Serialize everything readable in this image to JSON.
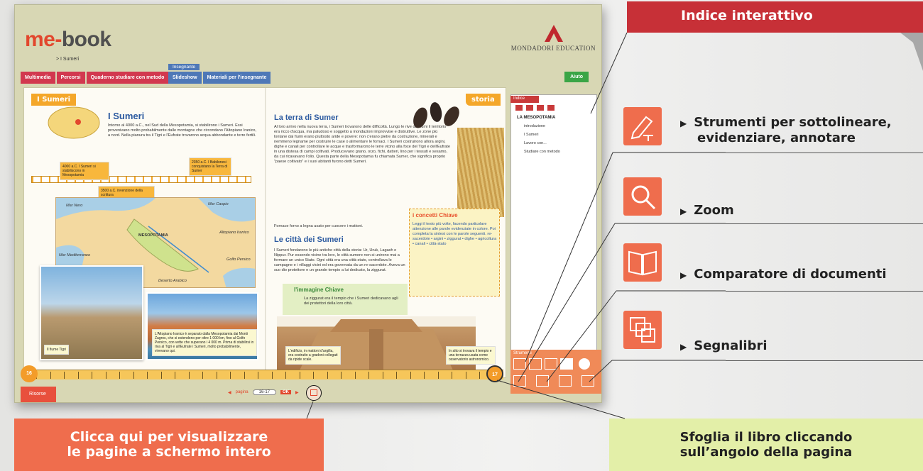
{
  "app": {
    "logo_me": "me-",
    "logo_book": "book",
    "breadcrumb": "> I Sumeri",
    "publisher": "MONDADORI EDUCATION",
    "tabs_left": [
      "Multimedia",
      "Percorsi",
      "Quaderno studiare con metodo"
    ],
    "teacher_label": "Insegnante",
    "tabs_teacher": [
      "Slideshow",
      "Materiali per l'insegnante"
    ],
    "help": "Aiuto"
  },
  "book": {
    "left_tag": "I Sumeri",
    "right_tag": "storia",
    "left_title": "I Sumeri",
    "left_intro": "Intorno al 4000 a.C., nel Sud della Mesopotamia, si stabilirono i Sumeri. Essi provenivano molto probabilmente dalle montagne che circondano l'Altopiano Iranico, a nord. Nella pianura tra il Tigri e l'Eufrate trovarono acqua abbondante e terre fertili.",
    "timeline_a": "4000 a.C. I Sumeri si stabiliscono in Mesopotamia",
    "timeline_b": "2350 a.C. I Babilonesi conquistano la Terra di Sumer",
    "timeline_c": "3500 a.C. invenzione della scrittura",
    "map_labels": [
      "Mar Nero",
      "Mar Caspio",
      "MESOPOTAMIA",
      "Mar Mediterraneo",
      "Deserto Arabico",
      "Golfo Persico",
      "Altopiano Iranico"
    ],
    "caption_river": "Il fiume Tigri",
    "caption_plateau": "L'Altopiano Iranico è separato dalla Mesopotamia dai Monti Zagros, che si estendono per oltre 1 000 km, fino al Golfo Persico, con vette che superano i 4 000 m. Prima di stabilirsi in riva al Tigri e all'Eufrate i Sumeri, molto probabilmente, vivevano qui.",
    "sec1_title": "La terra di Sumer",
    "sec1_text": "Al loro arrivo nella nuova terra, i Sumeri trovarono delle difficoltà. Lungo le rive dei fiumi il territorio era ricco d'acqua, ma paludoso e soggetto a inondazioni improvvise e distruttive. Le zone più lontane dai fiumi erano piuttosto aride e povere: non c'erano pietre da costruzione, minerali e nemmeno legname per costruire le case o alimentare le fornaci. I Sumeri costruirono allora argini, dighe e canali per controllare le acque e trasformarono le terre vicino alla foce del Tigri e dell'Eufrate in una distesa di campi coltivati. Producevano grano, orzo, fichi, datteri, lino per i tessuti e sesamo, da cui ricavavano l'olio. Questa parte della Mesopotamia fu chiamata Sumer, che significa proprio \"paese coltivato\" e i suoi abitanti furono detti Sumeri.",
    "glossary": "Fornace forno a legna usato per cuocere i mattoni.",
    "sec2_title": "Le città dei Sumeri",
    "sec2_text": "I Sumeri fondarono le più antiche città della storia: Ur, Uruk, Lagash e Nippur. Pur essendo vicine tra loro, le città sumere non si unirono mai a formare un unico Stato. Ogni città era una città-stato, controllava le campagne e i villaggi vicini ed era governata da un re-sacerdote. Aveva un suo dio protettore e un grande tempio a lui dedicato, la ziggurat.",
    "concepts_title": "i concetti Chiave",
    "concepts_text": "Leggi il testo più volte, facendo particolare attenzione alle parole evidenziate in colore. Poi completa la sintesi con le parole seguenti. re-sacerdote • argini • ziggurat • dighe • agricoltura • canali • città-stato",
    "image_key_title": "l'immagine Chiave",
    "image_key_text": "La ziggurat era il tempio che i Sumeri dedicavano agli dei protettori della loro città.",
    "note_brick": "L'edificio, in mattoni d'argilla, era costruito a gradoni collegati da ripide scale.",
    "note_top": "In alto si trovava il tempio e una terrazza usata come osservatorio astronomico.",
    "page_left": "16",
    "page_right": "17"
  },
  "index": {
    "tab": "Indice",
    "heading": "LA MESOPOTAMIA",
    "items": [
      "introduzione",
      "I Sumeri",
      "Lavoro con...",
      "Studiare con metodo"
    ],
    "tools_label": "Strumenti"
  },
  "footer": {
    "resources": "Risorse",
    "pager_label": "pagina",
    "page_value": "16-17",
    "ok": "OK"
  },
  "annotations": {
    "index_banner": "Indice interattivo",
    "feature_tools_1": "Strumenti per sottolineare,",
    "feature_tools_2": "evidenziare, annotare",
    "feature_zoom": "Zoom",
    "feature_compare": "Comparatore di documenti",
    "feature_bookmarks": "Segnalibri",
    "fullscreen_1": "Clicca qui per visualizzare",
    "fullscreen_2": "le pagine a schermo intero",
    "flip_1": "Sfoglia il libro cliccando",
    "flip_2": "sull’angolo della pagina"
  },
  "colors": {
    "brand_red": "#c73037",
    "accent_orange": "#ef6d4d",
    "callout_green": "#e3efa8",
    "app_bg": "#d8d7b4"
  }
}
